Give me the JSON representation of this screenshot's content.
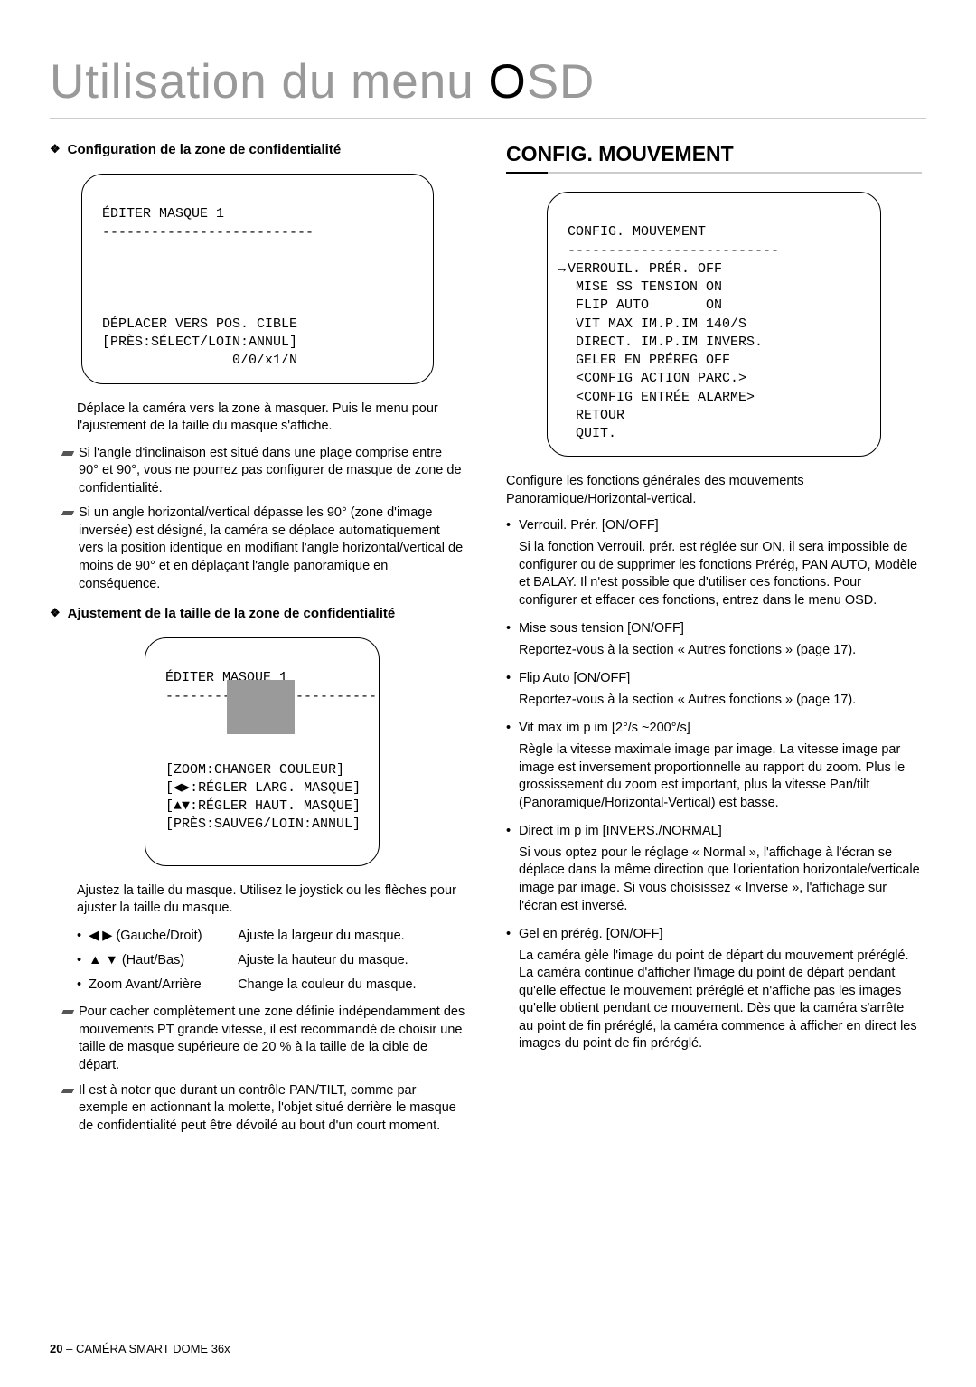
{
  "page_title_plain": "Utilisation du menu ",
  "page_title_highlight": "O",
  "page_title_rest": "SD",
  "left": {
    "sub1": "Configuration de la zone de confidentialité",
    "diag1_title": "ÉDITER MASQUE 1",
    "diag1_dashes": "--------------------------",
    "diag1_l1": "DÉPLACER VERS POS. CIBLE",
    "diag1_l2": "[PRÈS:SÉLECT/LOIN:ANNUL]",
    "diag1_l3": "                0/0/x1/N",
    "body1": "Déplace la caméra vers la zone à masquer. Puis le menu pour l'ajustement de la taille du masque s'affiche.",
    "note1": "Si l'angle d'inclinaison est situé dans une plage comprise entre 90° et 90°, vous ne pourrez pas configurer de masque de zone de confidentialité.",
    "note2": "Si un angle horizontal/vertical dépasse les 90° (zone d'image inversée) est désigné, la caméra se déplace automatiquement vers la position identique en modifiant l'angle horizontal/vertical de moins de 90° et en déplaçant l'angle panoramique en conséquence.",
    "sub2": "Ajustement de la taille de la zone de confidentialité",
    "diag2_title": "ÉDITER MASQUE 1",
    "diag2_dashes": "--------------------------",
    "diag2_l1": "[ZOOM:CHANGER COULEUR]",
    "diag2_l2": "[◀▶:RÉGLER LARG. MASQUE]",
    "diag2_l3": "[▲▼:RÉGLER HAUT. MASQUE]",
    "diag2_l4": "[PRÈS:SAUVEG/LOIN:ANNUL]",
    "body2": "Ajustez la taille du masque. Utilisez le joystick ou les flèches pour ajuster la taille du masque.",
    "row1_sym": "◀ ▶",
    "row1_lbl": "(Gauche/Droit)",
    "row1_val": "Ajuste la largeur du masque.",
    "row2_sym": "▲ ▼",
    "row2_lbl": "(Haut/Bas)",
    "row2_val": "Ajuste la hauteur du masque.",
    "row3_sym": "",
    "row3_lbl": "Zoom Avant/Arrière",
    "row3_val": "Change la couleur du masque.",
    "note3": "Pour cacher complètement une zone définie indépendamment des mouvements PT grande vitesse, il est recommandé de choisir une taille de masque supérieure de 20 % à la taille de la cible de départ.",
    "note4": "Il est à noter que durant un contrôle PAN/TILT, comme par exemple en actionnant la molette, l'objet situé derrière le masque de confidentialité peut être dévoilé au bout d'un court moment."
  },
  "right": {
    "section_title": "CONFIG. MOUVEMENT",
    "diag_title": "CONFIG. MOUVEMENT",
    "diag_dashes": "--------------------------",
    "diag_r1": "VERROUIL. PRÉR. OFF",
    "diag_r2": " MISE SS TENSION ON",
    "diag_r3": " FLIP AUTO       ON",
    "diag_r4": " VIT MAX IM.P.IM 140/S",
    "diag_r5": " DIRECT. IM.P.IM INVERS.",
    "diag_r6": " GELER EN PRÉREG OFF",
    "diag_r7": " <CONFIG ACTION PARC.>",
    "diag_r8": " <CONFIG ENTRÉE ALARME>",
    "diag_r9": " RETOUR",
    "diag_r10": " QUIT.",
    "body": "Configure les fonctions générales des mouvements Panoramique/Horizontal-vertical.",
    "b1h": "Verrouil. Prér. [ON/OFF]",
    "b1d": "Si la fonction Verrouil. prér. est réglée sur ON, il sera impossible de configurer ou de supprimer les fonctions Prérég, PAN AUTO, Modèle et BALAY. Il n'est possible que d'utiliser ces fonctions. Pour configurer et effacer ces fonctions, entrez dans le menu OSD.",
    "b2h": "Mise sous tension [ON/OFF]",
    "b2d": "Reportez-vous à la section « Autres fonctions » (page 17).",
    "b3h": "Flip Auto [ON/OFF]",
    "b3d": "Reportez-vous à la section « Autres fonctions » (page 17).",
    "b4h": "Vit max im p im [2°/s ~200°/s]",
    "b4d": "Règle la vitesse maximale image par image. La vitesse image par image est inversement proportionnelle au rapport du zoom. Plus le grossissement du zoom est important, plus la vitesse Pan/tilt (Panoramique/Horizontal-Vertical) est basse.",
    "b5h": "Direct im p im [INVERS./NORMAL]",
    "b5d": "Si vous optez pour le réglage « Normal », l'affichage à l'écran se déplace dans la même direction que l'orientation horizontale/verticale image par image. Si vous choisissez « Inverse », l'affichage sur l'écran est inversé.",
    "b6h": "Gel en prérég. [ON/OFF]",
    "b6d": "La caméra gèle l'image du point de départ du mouvement préréglé. La caméra continue d'afficher l'image du point de départ pendant qu'elle effectue le mouvement préréglé et n'affiche pas les images qu'elle obtient pendant ce mouvement. Dès que la caméra s'arrête au point de fin préréglé, la caméra commence à afficher en direct les images du point de fin préréglé."
  },
  "footer_pg": "20",
  "footer_dash": " – ",
  "footer_txt": "CAMÉRA SMART DOME 36x"
}
